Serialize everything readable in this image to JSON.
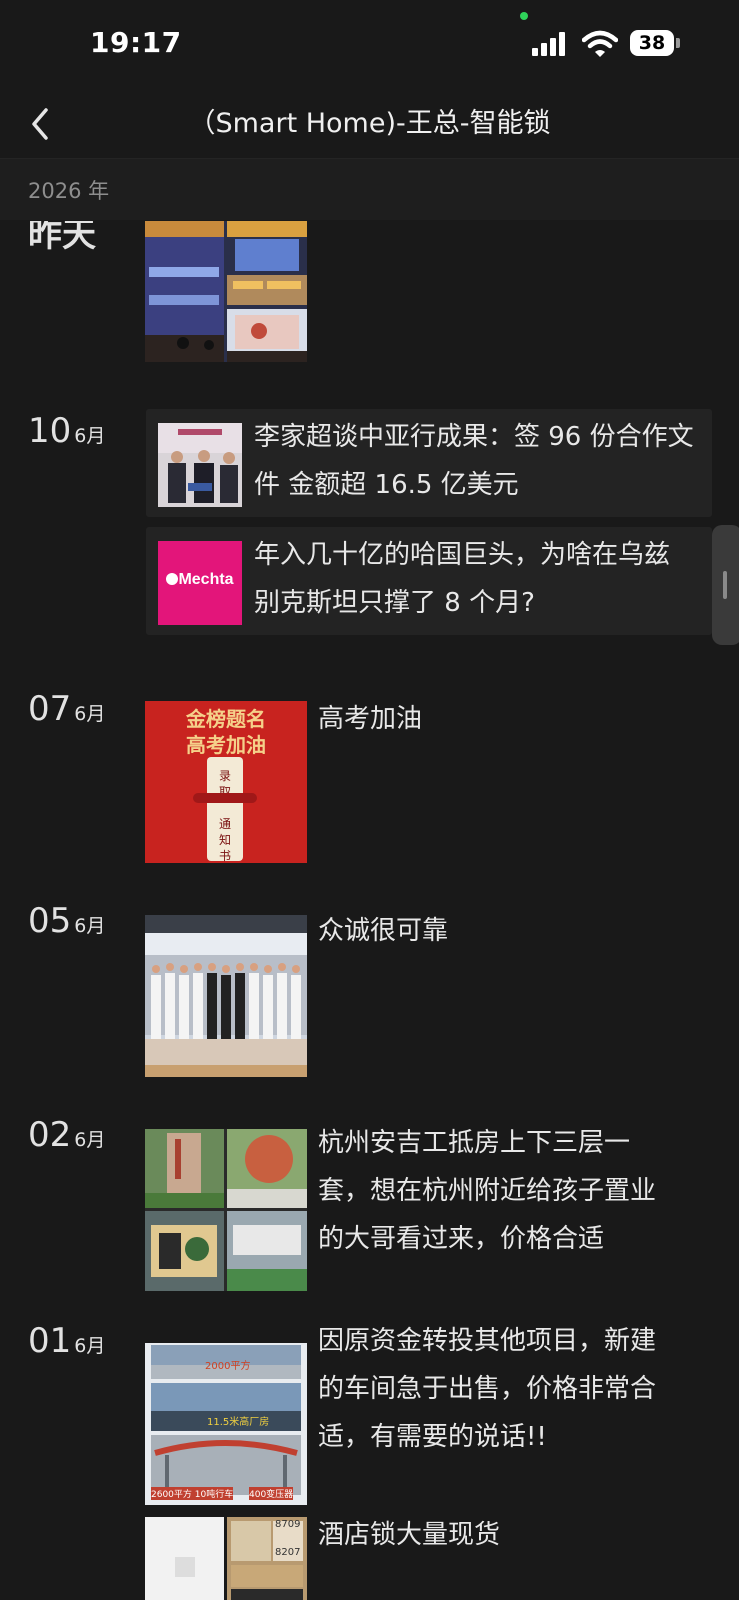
{
  "status_bar": {
    "time": "19:17",
    "battery": "38"
  },
  "header": {
    "title": "（Smart  Home)-王总-智能锁"
  },
  "year": "2026 年",
  "yesterday_label": "昨天",
  "month_suffix": "6月",
  "posts": [
    {
      "day": "10",
      "links": [
        {
          "text": "李家超谈中亚行成果：签 96 份合作文件 金额超 16.5 亿美元"
        },
        {
          "text": "年入几十亿的哈国巨头，为啥在乌兹别克斯坦只撑了 8 个月?",
          "thumb_label": "Mechta"
        }
      ]
    },
    {
      "day": "07",
      "text": "高考加油",
      "thumb_lines": [
        "金榜题名",
        "高考加油"
      ],
      "scroll_label": [
        "录",
        "取",
        "通",
        "知",
        "书"
      ]
    },
    {
      "day": "05",
      "text": "众诚很可靠"
    },
    {
      "day": "02",
      "text": "杭州安吉工抵房上下三层一套，想在杭州附近给孩子置业的大哥看过来，价格合适"
    },
    {
      "day": "01",
      "text": "因原资金转投其他项目，新建的车间急于出售，价格非常合适，有需要的说话!!",
      "thumb_labels": [
        "2000平方",
        "11.5米高厂房",
        "2600平方 10吨行车",
        "400变压器"
      ]
    },
    {
      "text": "酒店锁大量现货",
      "thumb_numbers": [
        "8709",
        "8207"
      ]
    }
  ],
  "colors": {
    "background": "#191919",
    "card": "#232323",
    "mechta": "#e3157a",
    "poster_red": "#c8231f"
  }
}
